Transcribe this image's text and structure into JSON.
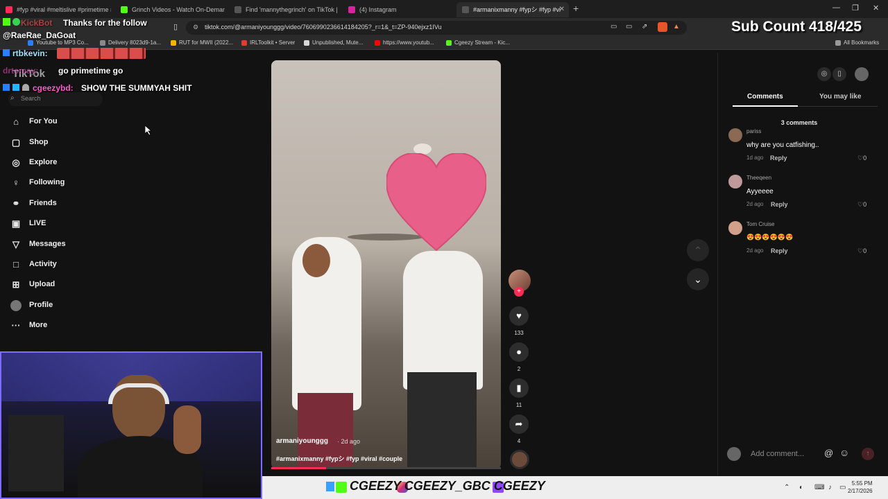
{
  "browser": {
    "tabs": [
      {
        "title": "#fyp #viral #meltislive #primetime #",
        "color": "#fe2c55"
      },
      {
        "title": "Grinch Videos - Watch On-Demand",
        "color": "#53fc18"
      },
      {
        "title": "Find 'mannythegrinch' on TikTok | Tik",
        "color": "#111"
      },
      {
        "title": "(4) Instagram",
        "color": "#d6249f"
      },
      {
        "title": "#armanixmanny #fypシ #fyp #vi",
        "color": "#111",
        "active": true
      }
    ],
    "new_tab": "+",
    "url": "tiktok.com/@armaniyounggg/video/7606990236614184205?_r=1&_t=ZP-940ejxz1IVu",
    "bookmarks": [
      {
        "label": "Youtube to MP3 Co...",
        "color": "#2b7fff"
      },
      {
        "label": "Delivery 8023d9-1a...",
        "color": "#8a8a8a"
      },
      {
        "label": "RUT for MWII (2022...",
        "color": "#f4b400"
      },
      {
        "label": "IRLToolkit • Server",
        "color": "#e53935"
      },
      {
        "label": "Unpublished, Mute...",
        "color": "#d8d8d8"
      },
      {
        "label": "https://www.youtub...",
        "color": "#ff0000"
      },
      {
        "label": "Cgeezy Stream - Kic...",
        "color": "#53fc18"
      }
    ],
    "all_bookmarks": "All Bookmarks"
  },
  "chat": [
    {
      "user": "",
      "message": "Thanks for the follow"
    },
    {
      "user": "@RaeRae_DaGoat",
      "message": ""
    },
    {
      "user": "rtbkevin:",
      "message": ""
    },
    {
      "user": "",
      "message": "go primetime go"
    },
    {
      "user": "cgeezybd:",
      "message": "SHOW THE SUMMYAH SHIT"
    }
  ],
  "sub_count": "Sub Count 418/425",
  "tiktok": {
    "logo": "TikTok",
    "search_placeholder": "Search",
    "nav": [
      {
        "label": "For You",
        "icon": "home-icon",
        "glyph": "⌂"
      },
      {
        "label": "Shop",
        "icon": "shopping-bag-icon",
        "glyph": "▢"
      },
      {
        "label": "Explore",
        "icon": "compass-icon",
        "glyph": "◎"
      },
      {
        "label": "Following",
        "icon": "following-icon",
        "glyph": "♀"
      },
      {
        "label": "Friends",
        "icon": "friends-icon",
        "glyph": "⚭"
      },
      {
        "label": "LIVE",
        "icon": "live-icon",
        "glyph": "▣"
      },
      {
        "label": "Messages",
        "icon": "messages-icon",
        "glyph": "▽"
      },
      {
        "label": "Activity",
        "icon": "activity-icon",
        "glyph": "□"
      },
      {
        "label": "Upload",
        "icon": "upload-icon",
        "glyph": "⊞"
      },
      {
        "label": "Profile",
        "icon": "profile-icon",
        "glyph": "●"
      },
      {
        "label": "More",
        "icon": "more-icon",
        "glyph": "···"
      }
    ],
    "video": {
      "username": "armaniyounggg",
      "time": "· 2d ago",
      "hashtags": "#armanixmanny #fypシ #fyp #viral #couple",
      "progress": 0.24
    },
    "actions": {
      "likes": "133",
      "comments": "2",
      "saves": "11",
      "shares": "4"
    },
    "panel": {
      "tab_comments": "Comments",
      "tab_may_like": "You may like",
      "comment_count": "3 comments",
      "comments": [
        {
          "user": "pariss",
          "text": "why are you catfishing..",
          "time": "1d ago",
          "reply": "Reply",
          "likes": "0",
          "avatar": "#8a6a55"
        },
        {
          "user": "Theeqeen",
          "text": "Ayyeeee",
          "time": "2d ago",
          "reply": "Reply",
          "likes": "0",
          "avatar": "#c09a9a"
        },
        {
          "user": "Tom Cruise",
          "text": "😍😍😍😍😍😍",
          "time": "2d ago",
          "reply": "Reply",
          "likes": "0",
          "avatar": "#d0a08a"
        }
      ],
      "add_comment_placeholder": "Add comment...",
      "mention": "@",
      "emoji": "☺",
      "post": "↑"
    }
  },
  "socials": "CGEEZY  CGEEZY_GBC  CGEEZY",
  "clock": {
    "time": "5:55 PM",
    "date": "2/17/2026"
  },
  "colors": {
    "accent": "#fe2c55",
    "kick": "#53fc18",
    "twitch": "#9146ff"
  }
}
